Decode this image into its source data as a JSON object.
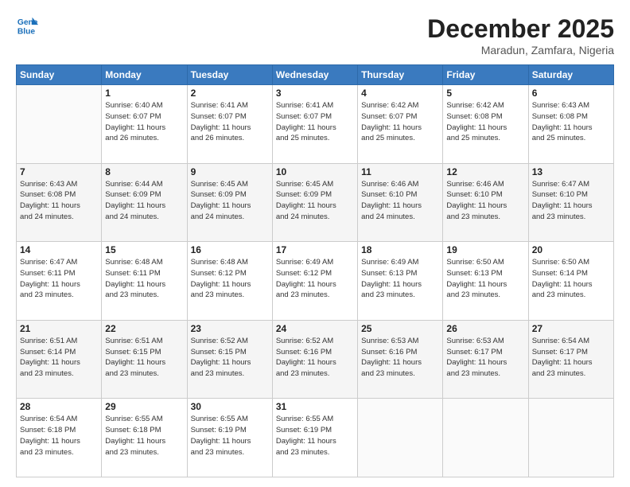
{
  "header": {
    "logo_line1": "General",
    "logo_line2": "Blue",
    "month": "December 2025",
    "location": "Maradun, Zamfara, Nigeria"
  },
  "days_of_week": [
    "Sunday",
    "Monday",
    "Tuesday",
    "Wednesday",
    "Thursday",
    "Friday",
    "Saturday"
  ],
  "weeks": [
    [
      {
        "day": "",
        "info": ""
      },
      {
        "day": "1",
        "info": "Sunrise: 6:40 AM\nSunset: 6:07 PM\nDaylight: 11 hours\nand 26 minutes."
      },
      {
        "day": "2",
        "info": "Sunrise: 6:41 AM\nSunset: 6:07 PM\nDaylight: 11 hours\nand 26 minutes."
      },
      {
        "day": "3",
        "info": "Sunrise: 6:41 AM\nSunset: 6:07 PM\nDaylight: 11 hours\nand 25 minutes."
      },
      {
        "day": "4",
        "info": "Sunrise: 6:42 AM\nSunset: 6:07 PM\nDaylight: 11 hours\nand 25 minutes."
      },
      {
        "day": "5",
        "info": "Sunrise: 6:42 AM\nSunset: 6:08 PM\nDaylight: 11 hours\nand 25 minutes."
      },
      {
        "day": "6",
        "info": "Sunrise: 6:43 AM\nSunset: 6:08 PM\nDaylight: 11 hours\nand 25 minutes."
      }
    ],
    [
      {
        "day": "7",
        "info": "Sunrise: 6:43 AM\nSunset: 6:08 PM\nDaylight: 11 hours\nand 24 minutes."
      },
      {
        "day": "8",
        "info": "Sunrise: 6:44 AM\nSunset: 6:09 PM\nDaylight: 11 hours\nand 24 minutes."
      },
      {
        "day": "9",
        "info": "Sunrise: 6:45 AM\nSunset: 6:09 PM\nDaylight: 11 hours\nand 24 minutes."
      },
      {
        "day": "10",
        "info": "Sunrise: 6:45 AM\nSunset: 6:09 PM\nDaylight: 11 hours\nand 24 minutes."
      },
      {
        "day": "11",
        "info": "Sunrise: 6:46 AM\nSunset: 6:10 PM\nDaylight: 11 hours\nand 24 minutes."
      },
      {
        "day": "12",
        "info": "Sunrise: 6:46 AM\nSunset: 6:10 PM\nDaylight: 11 hours\nand 23 minutes."
      },
      {
        "day": "13",
        "info": "Sunrise: 6:47 AM\nSunset: 6:10 PM\nDaylight: 11 hours\nand 23 minutes."
      }
    ],
    [
      {
        "day": "14",
        "info": "Sunrise: 6:47 AM\nSunset: 6:11 PM\nDaylight: 11 hours\nand 23 minutes."
      },
      {
        "day": "15",
        "info": "Sunrise: 6:48 AM\nSunset: 6:11 PM\nDaylight: 11 hours\nand 23 minutes."
      },
      {
        "day": "16",
        "info": "Sunrise: 6:48 AM\nSunset: 6:12 PM\nDaylight: 11 hours\nand 23 minutes."
      },
      {
        "day": "17",
        "info": "Sunrise: 6:49 AM\nSunset: 6:12 PM\nDaylight: 11 hours\nand 23 minutes."
      },
      {
        "day": "18",
        "info": "Sunrise: 6:49 AM\nSunset: 6:13 PM\nDaylight: 11 hours\nand 23 minutes."
      },
      {
        "day": "19",
        "info": "Sunrise: 6:50 AM\nSunset: 6:13 PM\nDaylight: 11 hours\nand 23 minutes."
      },
      {
        "day": "20",
        "info": "Sunrise: 6:50 AM\nSunset: 6:14 PM\nDaylight: 11 hours\nand 23 minutes."
      }
    ],
    [
      {
        "day": "21",
        "info": "Sunrise: 6:51 AM\nSunset: 6:14 PM\nDaylight: 11 hours\nand 23 minutes."
      },
      {
        "day": "22",
        "info": "Sunrise: 6:51 AM\nSunset: 6:15 PM\nDaylight: 11 hours\nand 23 minutes."
      },
      {
        "day": "23",
        "info": "Sunrise: 6:52 AM\nSunset: 6:15 PM\nDaylight: 11 hours\nand 23 minutes."
      },
      {
        "day": "24",
        "info": "Sunrise: 6:52 AM\nSunset: 6:16 PM\nDaylight: 11 hours\nand 23 minutes."
      },
      {
        "day": "25",
        "info": "Sunrise: 6:53 AM\nSunset: 6:16 PM\nDaylight: 11 hours\nand 23 minutes."
      },
      {
        "day": "26",
        "info": "Sunrise: 6:53 AM\nSunset: 6:17 PM\nDaylight: 11 hours\nand 23 minutes."
      },
      {
        "day": "27",
        "info": "Sunrise: 6:54 AM\nSunset: 6:17 PM\nDaylight: 11 hours\nand 23 minutes."
      }
    ],
    [
      {
        "day": "28",
        "info": "Sunrise: 6:54 AM\nSunset: 6:18 PM\nDaylight: 11 hours\nand 23 minutes."
      },
      {
        "day": "29",
        "info": "Sunrise: 6:55 AM\nSunset: 6:18 PM\nDaylight: 11 hours\nand 23 minutes."
      },
      {
        "day": "30",
        "info": "Sunrise: 6:55 AM\nSunset: 6:19 PM\nDaylight: 11 hours\nand 23 minutes."
      },
      {
        "day": "31",
        "info": "Sunrise: 6:55 AM\nSunset: 6:19 PM\nDaylight: 11 hours\nand 23 minutes."
      },
      {
        "day": "",
        "info": ""
      },
      {
        "day": "",
        "info": ""
      },
      {
        "day": "",
        "info": ""
      }
    ]
  ]
}
